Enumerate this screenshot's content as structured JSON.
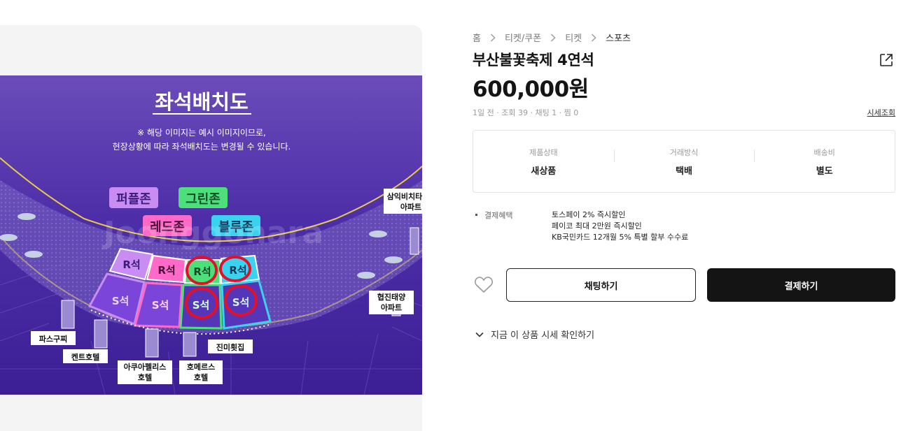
{
  "breadcrumb": [
    "홈",
    "티켓/쿠폰",
    "티켓",
    "스포츠"
  ],
  "product": {
    "title": "부산불꽃축제 4연석",
    "price": "600,000원",
    "meta": "1일 전 · 조회 39 · 채팅 1 · 찜 0",
    "price_check_label": "시세조회"
  },
  "info": [
    {
      "label": "제품상태",
      "value": "새상품"
    },
    {
      "label": "거래방식",
      "value": "택배"
    },
    {
      "label": "배송비",
      "value": "별도"
    }
  ],
  "benefit": {
    "label": "결제혜택",
    "lines": [
      "토스페이 2% 즉시할인",
      "페이코 최대 2만원 즉시할인",
      "KB국민카드 12개월 5% 특별 할부 수수료"
    ]
  },
  "buttons": {
    "chat": "채팅하기",
    "pay": "결제하기"
  },
  "market_toggle": "지금 이 상품 시세 확인하기",
  "icons": {
    "share": "share-icon",
    "wish": "heart-icon",
    "chevron": "chevron-down-icon",
    "breadcrumb_sep": "chevron-right-icon"
  },
  "seat_map": {
    "title": "좌석배치도",
    "notice_lines": [
      "※ 해당 이미지는 예시 이미지이므로,",
      "현장상황에 따라 좌석배치도는 변경될 수 있습니다."
    ],
    "zones": {
      "purple": "퍼플존",
      "green": "그린존",
      "red": "레드존",
      "blue": "블루존"
    },
    "seat_r": "R석",
    "seat_s": "S석",
    "landmarks": {
      "samik": [
        "삼익비치타",
        "아파트"
      ],
      "hyupjin": [
        "협진태양",
        "아파트"
      ],
      "pasta": "파스구찌",
      "kent": "켄트호텔",
      "aqua": [
        "아쿠아펠리스",
        "호텔"
      ],
      "homeros": [
        "호메르스",
        "호텔"
      ],
      "jinmi": "진미횟집"
    },
    "watermark": "Joonggonara",
    "colors": {
      "bg": "#4a2aa8",
      "purple_zone": "#c98cf3",
      "green_zone": "#4de07a",
      "red_zone": "#ff6ac8",
      "blue_zone": "#3ad2ee",
      "annotation": "#e3102a"
    }
  }
}
